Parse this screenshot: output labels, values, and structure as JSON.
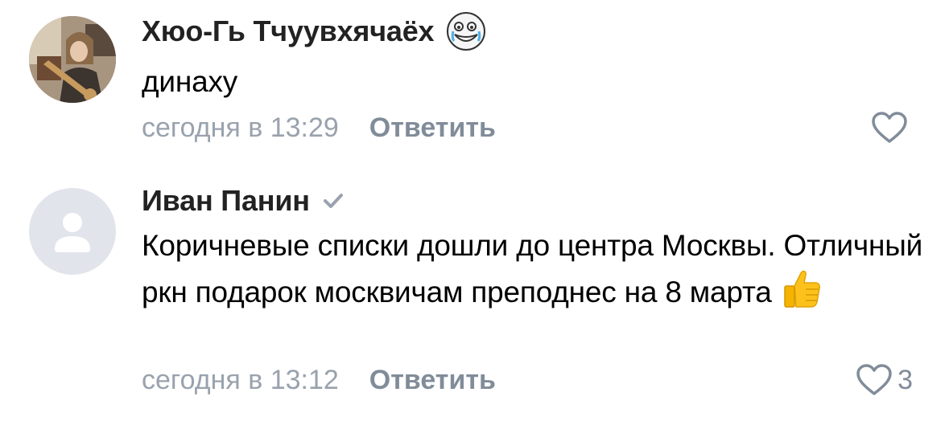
{
  "comments": [
    {
      "author": "Хюо-Гь Тчуувхячаёх",
      "text": "динаху",
      "timestamp": "сегодня в 13:29",
      "reply_label": "Ответить",
      "like_count": "",
      "author_badge_icon": "sticker-face-icon"
    },
    {
      "author": "Иван Панин",
      "text": "Коричневые списки дошли до центра Москвы. Отличный ркн подарок москвичам преподнес на 8 марта",
      "timestamp": "сегодня в 13:12",
      "reply_label": "Ответить",
      "like_count": "3",
      "author_badge_icon": "verified-check-icon",
      "text_emoji": "thumbs-up-emoji"
    }
  ],
  "colors": {
    "author": "#222222",
    "meta": "#99a2ad",
    "action": "#818c99",
    "avatar_placeholder": "#e1e5eb",
    "avatar_figure": "#ffffff"
  }
}
